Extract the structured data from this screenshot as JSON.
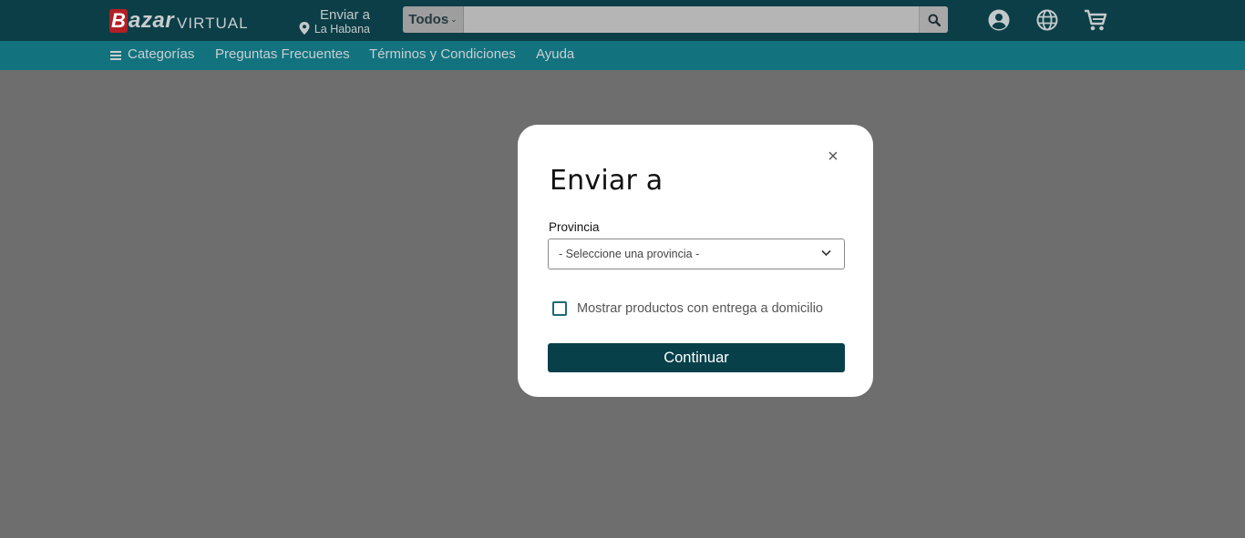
{
  "header": {
    "logo": {
      "letter": "B",
      "main": "azar",
      "sub": "VIRTUAL"
    },
    "deliver": {
      "title": "Enviar a",
      "location": "La Habana",
      "icon": "map-pin-icon"
    },
    "search": {
      "category": "Todos",
      "placeholder": "",
      "icon": "search-icon"
    },
    "icons": [
      "account-icon",
      "globe-icon",
      "cart-icon"
    ]
  },
  "subnav": {
    "menu_icon": "hamburger-icon",
    "items": [
      "Categorías",
      "Preguntas Frecuentes",
      "Términos y Condiciones",
      "Ayuda"
    ]
  },
  "modal": {
    "title": "Enviar a",
    "province_label": "Provincia",
    "province_select": "- Seleccione una provincia -",
    "close_icon": "×",
    "checkbox_label": "Mostrar productos con entrega a domicilio",
    "checkbox_checked": false,
    "continue_label": "Continuar"
  },
  "colors": {
    "topbar": "#0c3e47",
    "subnav": "#12737f",
    "overlay": "#6e6e6e",
    "button": "#08404a",
    "brand_red": "#b21f24"
  }
}
